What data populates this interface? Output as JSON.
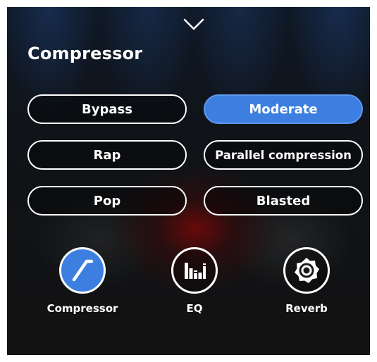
{
  "header": {
    "collapse_icon": "chevron-down-icon",
    "title": "Compressor"
  },
  "presets": [
    {
      "label": "Bypass",
      "active": false
    },
    {
      "label": "Moderate",
      "active": true
    },
    {
      "label": "Rap",
      "active": false
    },
    {
      "label": "Parallel compression",
      "active": false
    },
    {
      "label": "Pop",
      "active": false
    },
    {
      "label": "Blasted",
      "active": false
    }
  ],
  "modules": [
    {
      "label": "Compressor",
      "icon": "compressor-curve-icon",
      "active": true
    },
    {
      "label": "EQ",
      "icon": "equalizer-icon",
      "active": false
    },
    {
      "label": "Reverb",
      "icon": "reverb-icon",
      "active": false
    }
  ],
  "colors": {
    "accent": "#3d7fe0",
    "text": "#ffffff",
    "background": "#121212"
  }
}
